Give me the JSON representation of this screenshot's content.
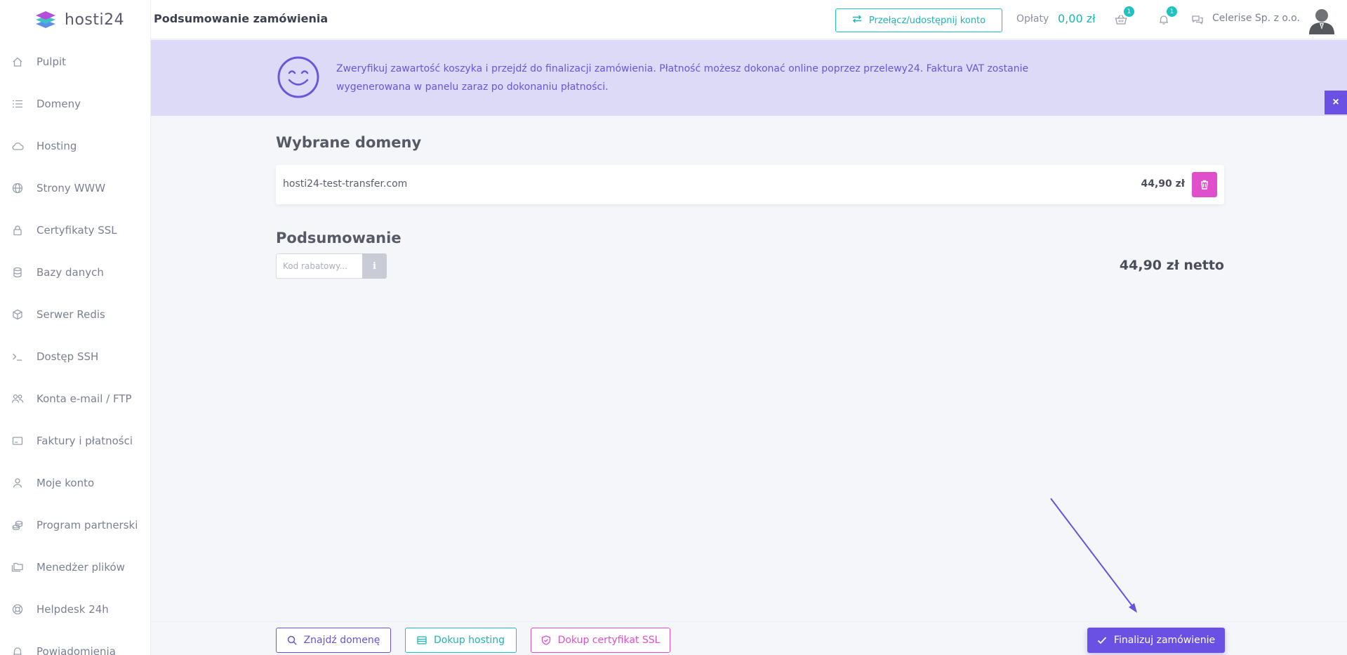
{
  "brand": {
    "logo_text": "hosti24"
  },
  "sidebar": {
    "items": [
      {
        "label": "Pulpit",
        "icon": "home-icon"
      },
      {
        "label": "Domeny",
        "icon": "list-icon"
      },
      {
        "label": "Hosting",
        "icon": "cloud-icon"
      },
      {
        "label": "Strony WWW",
        "icon": "globe-icon"
      },
      {
        "label": "Certyfikaty SSL",
        "icon": "lock-icon"
      },
      {
        "label": "Bazy danych",
        "icon": "database-icon"
      },
      {
        "label": "Serwer Redis",
        "icon": "cube-icon"
      },
      {
        "label": "Dostęp SSH",
        "icon": "terminal-icon"
      },
      {
        "label": "Konta e-mail / FTP",
        "icon": "users-icon"
      },
      {
        "label": "Faktury i płatności",
        "icon": "invoice-icon"
      },
      {
        "label": "Moje konto",
        "icon": "user-icon"
      },
      {
        "label": "Program partnerski",
        "icon": "coins-icon"
      },
      {
        "label": "Menedżer plików",
        "icon": "folders-icon"
      },
      {
        "label": "Helpdesk 24h",
        "icon": "lifebuoy-icon"
      },
      {
        "label": "Powiadomienia",
        "icon": "bell-icon"
      }
    ]
  },
  "header": {
    "title": "Podsumowanie zamówienia",
    "switch_label": "Przełącz/udostępnij konto",
    "fees_label": "Opłaty",
    "fees_value": "0,00 zł",
    "cart_badge": "1",
    "notif_badge": "1",
    "company": "Celerise Sp. z o.o."
  },
  "banner": {
    "text": "Zweryfikuj zawartość koszyka i przejdź do finalizacji zamówienia. Płatność możesz dokonać online poprzez przelewy24. Faktura VAT zostanie wygenerowana w panelu zaraz po dokonaniu płatności.",
    "close": "×"
  },
  "main": {
    "domains_title": "Wybrane domeny",
    "domains": [
      {
        "name": "hosti24-test-transfer.com",
        "price": "44,90 zł"
      }
    ],
    "summary_title": "Podsumowanie",
    "coupon_placeholder": "Kod rabatowy...",
    "info_label": "i",
    "total": "44,90 zł netto"
  },
  "footer": {
    "find_domain": "Znajdź domenę",
    "add_hosting": "Dokup hosting",
    "add_ssl": "Dokup certyfikat SSL",
    "finalize": "Finalizuj zamówienie"
  },
  "colors": {
    "accent_purple": "#6b51e3",
    "accent_teal": "#1fc1c3",
    "accent_pink": "#e04fcb",
    "banner_bg": "#dcdaf7"
  }
}
